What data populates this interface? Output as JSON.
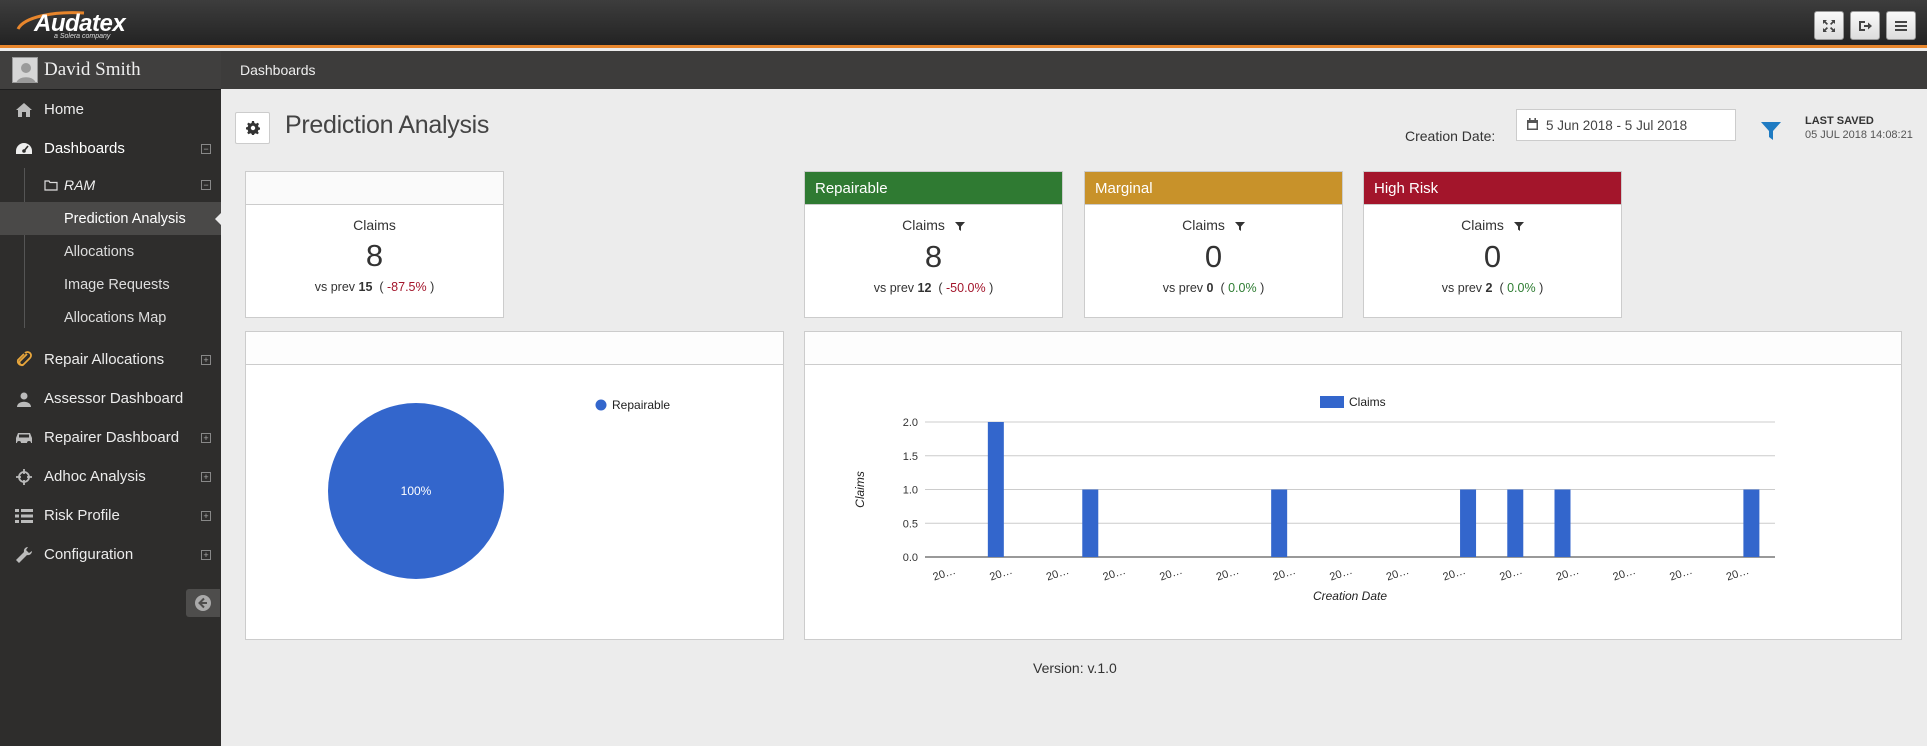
{
  "app": {
    "logo_text": "Audatex",
    "logo_sub": "a Solera company"
  },
  "toolbar": {
    "icons": [
      "fullscreen-icon",
      "logout-icon",
      "menu-icon"
    ]
  },
  "user": {
    "name": "David Smith"
  },
  "sidebar": {
    "items": [
      {
        "label": "Home",
        "icon": "home-icon"
      },
      {
        "label": "Dashboards",
        "icon": "dashboard-icon",
        "expanded": true
      },
      {
        "label": "Repair Allocations",
        "icon": "paperclip-icon"
      },
      {
        "label": "Assessor Dashboard",
        "icon": "user-icon"
      },
      {
        "label": "Repairer Dashboard",
        "icon": "car-icon"
      },
      {
        "label": "Adhoc Analysis",
        "icon": "crosshair-icon"
      },
      {
        "label": "Risk Profile",
        "icon": "list-icon"
      },
      {
        "label": "Configuration",
        "icon": "wrench-icon"
      }
    ],
    "folder": {
      "label": "RAM"
    },
    "subitems": [
      {
        "label": "Prediction Analysis",
        "selected": true
      },
      {
        "label": "Allocations"
      },
      {
        "label": "Image Requests"
      },
      {
        "label": "Allocations Map"
      }
    ]
  },
  "breadcrumb": {
    "label": "Dashboards"
  },
  "page": {
    "title": "Prediction Analysis",
    "creation_date_label": "Creation Date:",
    "date_range": "5 Jun 2018 - 5 Jul 2018",
    "last_saved_label": "LAST SAVED",
    "last_saved_value": "05 JUL 2018 14:08:21"
  },
  "kpis": [
    {
      "header": "",
      "color": "#ffffff",
      "label": "Claims",
      "value": "8",
      "prev_label": "vs prev",
      "prev_value": "15",
      "change": "-87.5%"
    },
    {
      "header": "Repairable",
      "color": "#2f7a32",
      "label": "Claims",
      "value": "8",
      "prev_label": "vs prev",
      "prev_value": "12",
      "change": "-50.0%"
    },
    {
      "header": "Marginal",
      "color": "#c8922a",
      "label": "Claims",
      "value": "0",
      "prev_label": "vs prev",
      "prev_value": "0",
      "change": "0.0%"
    },
    {
      "header": "High Risk",
      "color": "#a3152b",
      "label": "Claims",
      "value": "0",
      "prev_label": "vs prev",
      "prev_value": "2",
      "change": "0.0%"
    }
  ],
  "chart_data": [
    {
      "type": "pie",
      "categories": [
        "Repairable"
      ],
      "values": [
        100
      ],
      "slice_label": "100%",
      "legend": [
        "Repairable"
      ],
      "colors": [
        "#3366cc"
      ]
    },
    {
      "type": "bar",
      "series": [
        {
          "name": "Claims",
          "values": [
            0,
            2,
            0,
            1,
            0,
            0,
            0,
            1,
            0,
            0,
            0,
            1,
            1,
            1,
            0,
            0,
            0,
            1
          ]
        }
      ],
      "x_tick_labels": [
        "20…",
        "20…",
        "20…",
        "20…",
        "20…",
        "20…",
        "20…",
        "20…",
        "20…",
        "20…",
        "20…",
        "20…",
        "20…",
        "20…",
        "20…"
      ],
      "y_ticks": [
        "0.0",
        "0.5",
        "1.0",
        "1.5",
        "2.0"
      ],
      "xlabel": "Creation Date",
      "ylabel": "Claims",
      "ylim": [
        0,
        2
      ],
      "legend": [
        "Claims"
      ],
      "colors": [
        "#3366cc"
      ]
    }
  ],
  "footer": {
    "version": "Version: v.1.0"
  }
}
